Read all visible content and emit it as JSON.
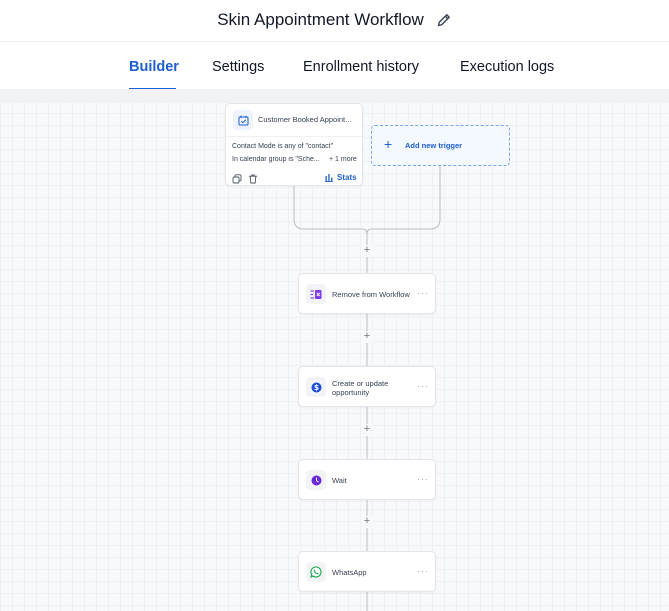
{
  "header": {
    "title": "Skin Appointment Workflow",
    "edit_icon": "pencil-icon"
  },
  "tabs": [
    {
      "label": "Builder",
      "active": true
    },
    {
      "label": "Settings",
      "active": false
    },
    {
      "label": "Enrollment history",
      "active": false
    },
    {
      "label": "Execution logs",
      "active": false
    }
  ],
  "colors": {
    "accent": "#1d5fd1",
    "remove_icon": "#7c3aed",
    "opportunity_icon": "#1d4ed8",
    "wait_icon": "#6d28d9",
    "whatsapp_icon": "#16a34a"
  },
  "trigger": {
    "name": "Customer Booked Appoint...",
    "icon": "calendar-check-icon",
    "filters": [
      "Contact Mode is any of \"contact\"",
      "In calendar group is \"Sche..."
    ],
    "more": "+ 1 more",
    "stats_label": "Stats"
  },
  "add_trigger": {
    "label": "Add new trigger"
  },
  "actions": [
    {
      "label": "Remove from Workflow",
      "icon": "remove-workflow-icon"
    },
    {
      "label_line1": "Create or update",
      "label_line2": "opportunity",
      "icon": "dollar-icon"
    },
    {
      "label": "Wait",
      "icon": "clock-icon"
    },
    {
      "label": "WhatsApp",
      "icon": "whatsapp-icon"
    }
  ],
  "plus_symbol": "+",
  "menu_symbol": "···"
}
